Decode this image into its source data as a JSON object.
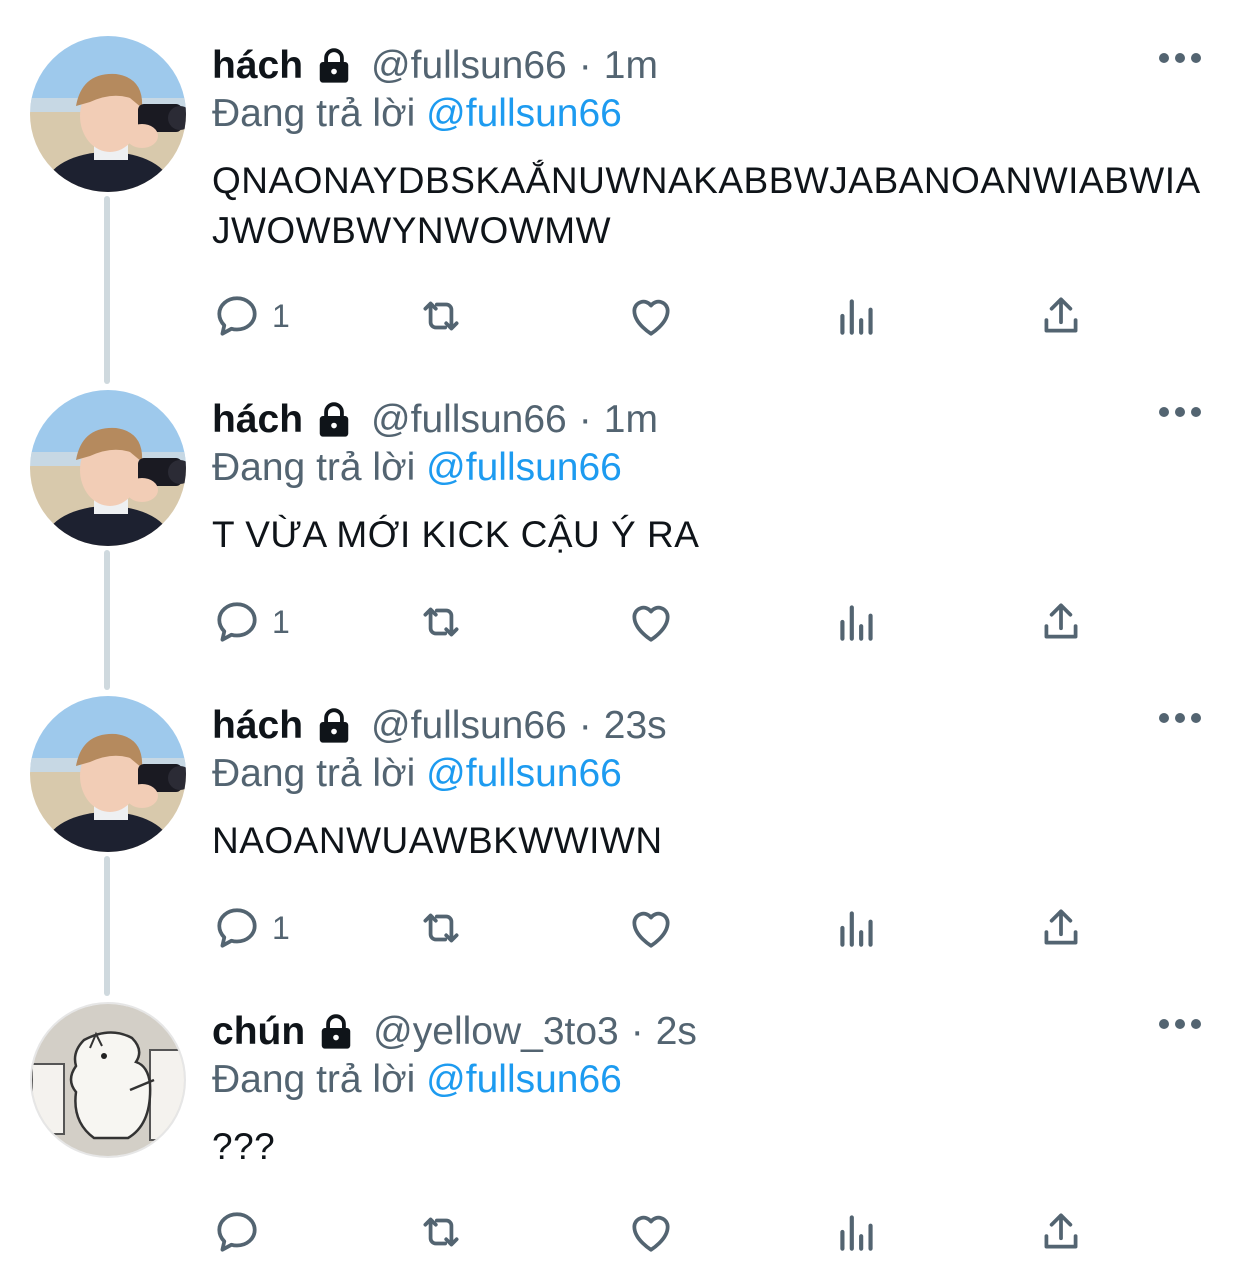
{
  "thread": [
    {
      "name": "hách",
      "handle": "@fullsun66",
      "separator": "·",
      "time": "1m",
      "replying_prefix": "Đang trả lời",
      "replying_to": "@fullsun66",
      "text": "QNAONAYDBSKAẮNUWNAKABBWJABANOANWIABWIAJWOWBWYNWOWMW",
      "reply_count": "1",
      "avatar_icon": "photo-avatar-camera"
    },
    {
      "name": "hách",
      "handle": "@fullsun66",
      "separator": "·",
      "time": "1m",
      "replying_prefix": "Đang trả lời",
      "replying_to": "@fullsun66",
      "text": "T VỪA MỚI KICK CẬU Ý RA",
      "reply_count": "1",
      "avatar_icon": "photo-avatar-camera"
    },
    {
      "name": "hách",
      "handle": "@fullsun66",
      "separator": "·",
      "time": "23s",
      "replying_prefix": "Đang trả lời",
      "replying_to": "@fullsun66",
      "text": "NAOANWUAWBKWWIWN",
      "reply_count": "1",
      "avatar_icon": "photo-avatar-camera"
    },
    {
      "name": "chún",
      "handle": "@yellow_3to3",
      "separator": "·",
      "time": "2s",
      "replying_prefix": "Đang trả lời",
      "replying_to": "@fullsun66",
      "text": "???",
      "reply_count": "",
      "avatar_icon": "photo-avatar-moomin"
    }
  ],
  "icons": {
    "protected": "lock-icon",
    "more": "more-icon",
    "reply": "reply-icon",
    "retweet": "retweet-icon",
    "like": "heart-icon",
    "views": "analytics-icon",
    "share": "share-icon"
  },
  "colors": {
    "text": "#0f1419",
    "secondary": "#536471",
    "mention": "#1d9bf0",
    "thread_line": "#cfd9de"
  }
}
